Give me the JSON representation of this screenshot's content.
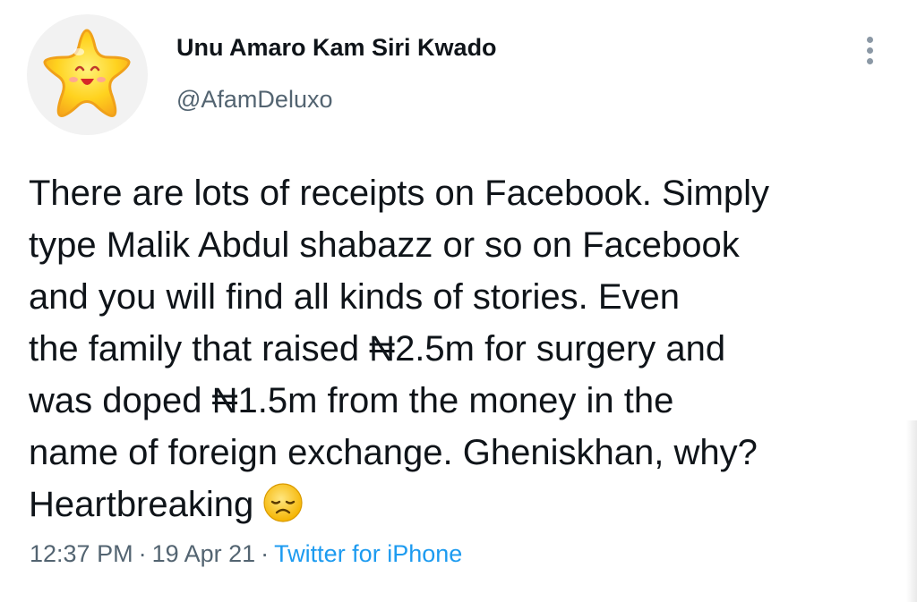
{
  "author": {
    "display_name": "Unu Amaro Kam Siri Kwado",
    "handle": "@AfamDeluxo",
    "avatar_icon": "smiling-star-avatar"
  },
  "menu": {
    "icon": "more-vertical-icon"
  },
  "tweet": {
    "lines": [
      "There are lots of receipts on Facebook. Simply",
      "type Malik Abdul shabazz or so on Facebook",
      "and you will find all kinds of stories. Even",
      "the family that raised ₦2.5m for surgery and",
      "was doped ₦1.5m from the money in the",
      "name of foreign exchange. Gheniskhan, why?",
      "Heartbreaking"
    ],
    "emoji": "disappointed-face-icon"
  },
  "meta": {
    "time": "12:37 PM",
    "date": "19 Apr 21",
    "separator": "·",
    "source": "Twitter for iPhone"
  },
  "colors": {
    "text_primary": "#0f1419",
    "text_secondary": "#536471",
    "link": "#1d9bf0",
    "avatar_background": "#f2f2f2",
    "star_fill": "#ffd21e",
    "star_outline": "#f0a11a"
  }
}
